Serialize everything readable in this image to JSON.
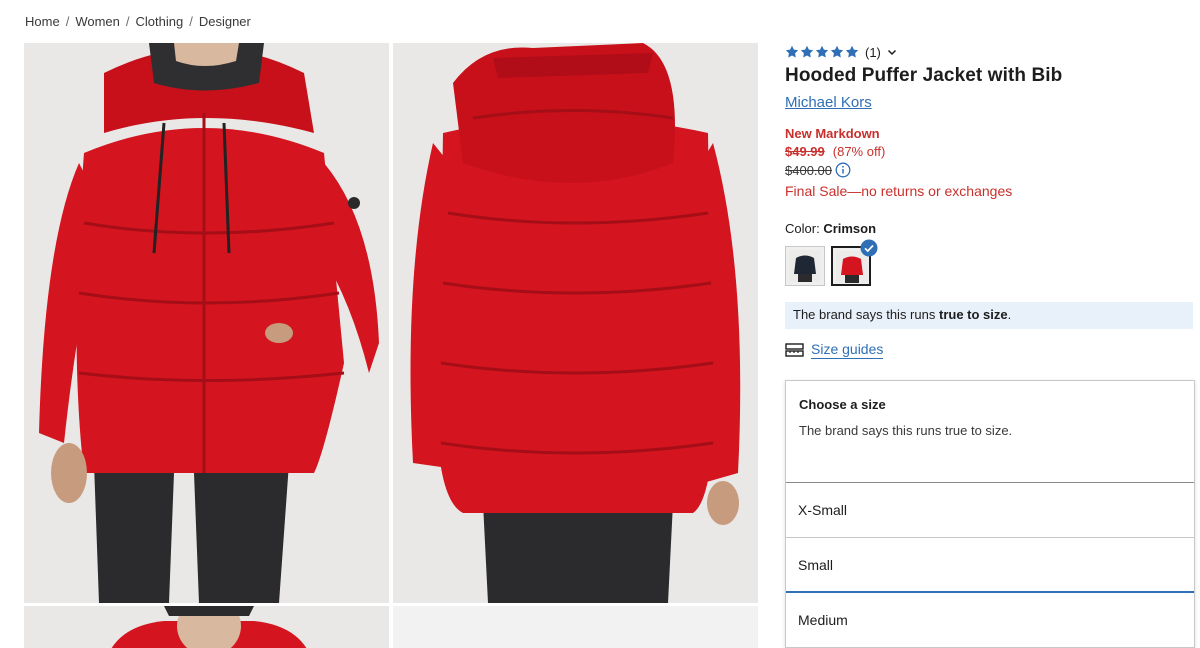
{
  "breadcrumb": [
    "Home",
    "Women",
    "Clothing",
    "Designer"
  ],
  "product": {
    "rating_count": "(1)",
    "stars": 5,
    "title": "Hooded Puffer Jacket with Bib",
    "brand": "Michael Kors",
    "badge": "New Markdown",
    "sale_price": "$49.99",
    "discount": "(87% off)",
    "original_price": "$400.00",
    "final_sale": "Final Sale—no returns or exchanges"
  },
  "color": {
    "label": "Color:",
    "selected": "Crimson",
    "swatches": [
      "navy",
      "crimson"
    ]
  },
  "fit": {
    "prefix": "The brand says this runs",
    "emphasis": "true to size",
    "suffix": "."
  },
  "size_guides_label": "Size guides",
  "size_select": {
    "heading": "Choose a size",
    "note": "The brand says this runs true to size.",
    "options": [
      "X-Small",
      "Small",
      "Medium"
    ],
    "active_option": "Small"
  },
  "colors": {
    "accent": "#2f6fb5",
    "sale": "#c9302c",
    "jacket": "#d4141f",
    "banner": "#e8f1f9"
  }
}
